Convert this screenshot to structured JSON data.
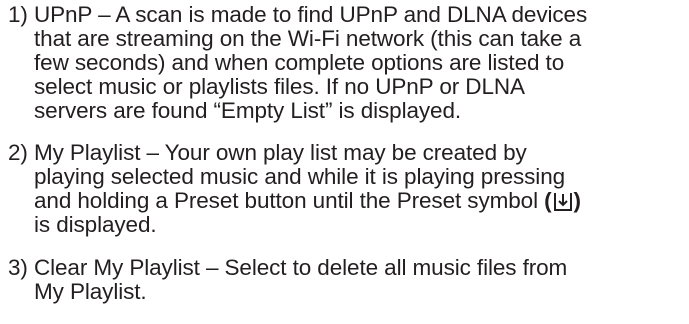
{
  "items": [
    {
      "lines": [
        "1) UPnP – A scan is made to find UPnP and DLNA devices",
        "that are streaming on the Wi-Fi network (this can take a",
        "few seconds) and when complete options are listed to",
        "select music or playlists files. If no UPnP or DLNA",
        "servers are found “Empty List” is displayed."
      ]
    },
    {
      "lines": [
        "2) My Playlist – Your own play list may be created by",
        "playing selected music and while it is playing pressing",
        "and holding a Preset button until the Preset symbol",
        "is displayed."
      ],
      "paren_open": "(",
      "paren_close": ")",
      "symbol_icon": "preset-symbol-icon"
    },
    {
      "lines": [
        "3) Clear My Playlist – Select to delete all music files from",
        "My Playlist."
      ]
    }
  ],
  "colors": {
    "text": "#231f20",
    "background": "#ffffff"
  }
}
